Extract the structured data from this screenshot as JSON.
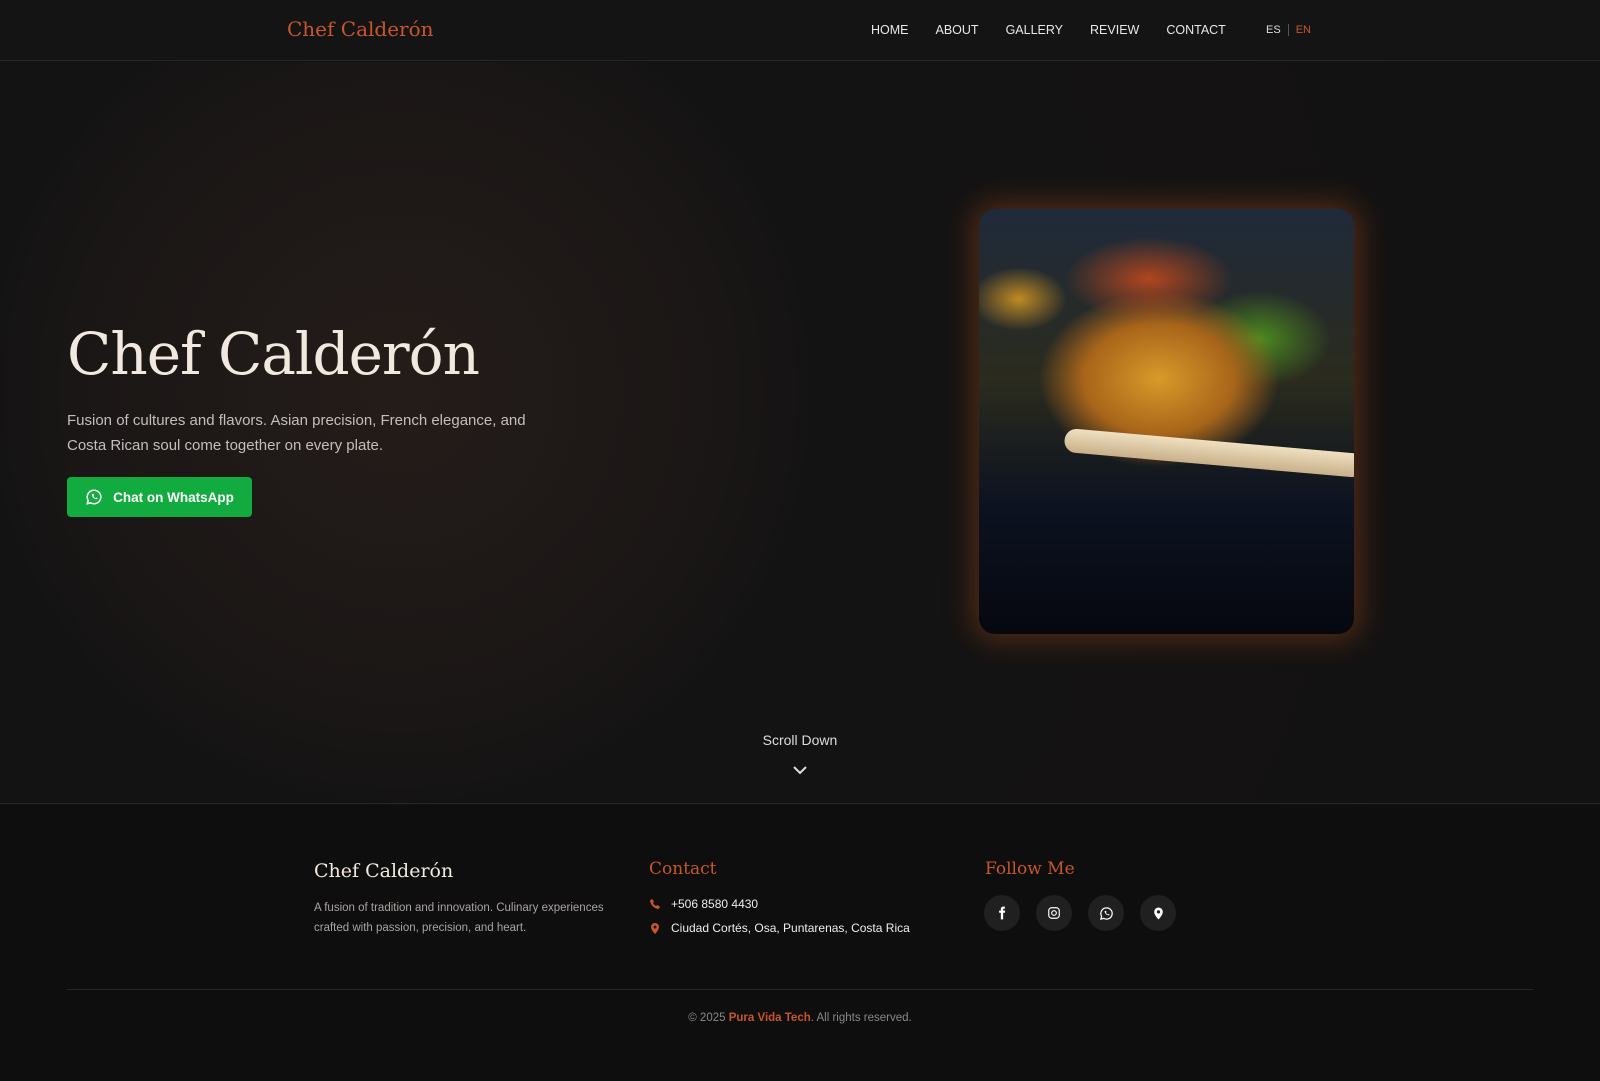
{
  "nav": {
    "logo": "Chef Calderón",
    "items": [
      "HOME",
      "ABOUT",
      "GALLERY",
      "REVIEW",
      "CONTACT"
    ],
    "lang": {
      "es": "ES",
      "en": "EN",
      "active": "EN"
    }
  },
  "hero": {
    "title": "Chef Calderón",
    "subtitle": "Fusion of cultures and flavors. Asian precision, French elegance, and Costa Rican soul come together on every plate.",
    "cta": "Chat on WhatsApp",
    "scroll": "Scroll Down"
  },
  "footer": {
    "brand": "Chef Calderón",
    "description": "A fusion of tradition and innovation. Culinary experiences crafted with passion, precision, and heart.",
    "contact_title": "Contact",
    "phone": "+506 8580 4430",
    "address": "Ciudad Cortés, Osa, Puntarenas, Costa Rica",
    "follow_title": "Follow Me",
    "copyright_pre": "© 2025 ",
    "company": "Pura Vida Tech",
    "copyright_post": ". All rights reserved."
  },
  "colors": {
    "accent": "#c8562a",
    "whatsapp": "#12ab3f"
  }
}
